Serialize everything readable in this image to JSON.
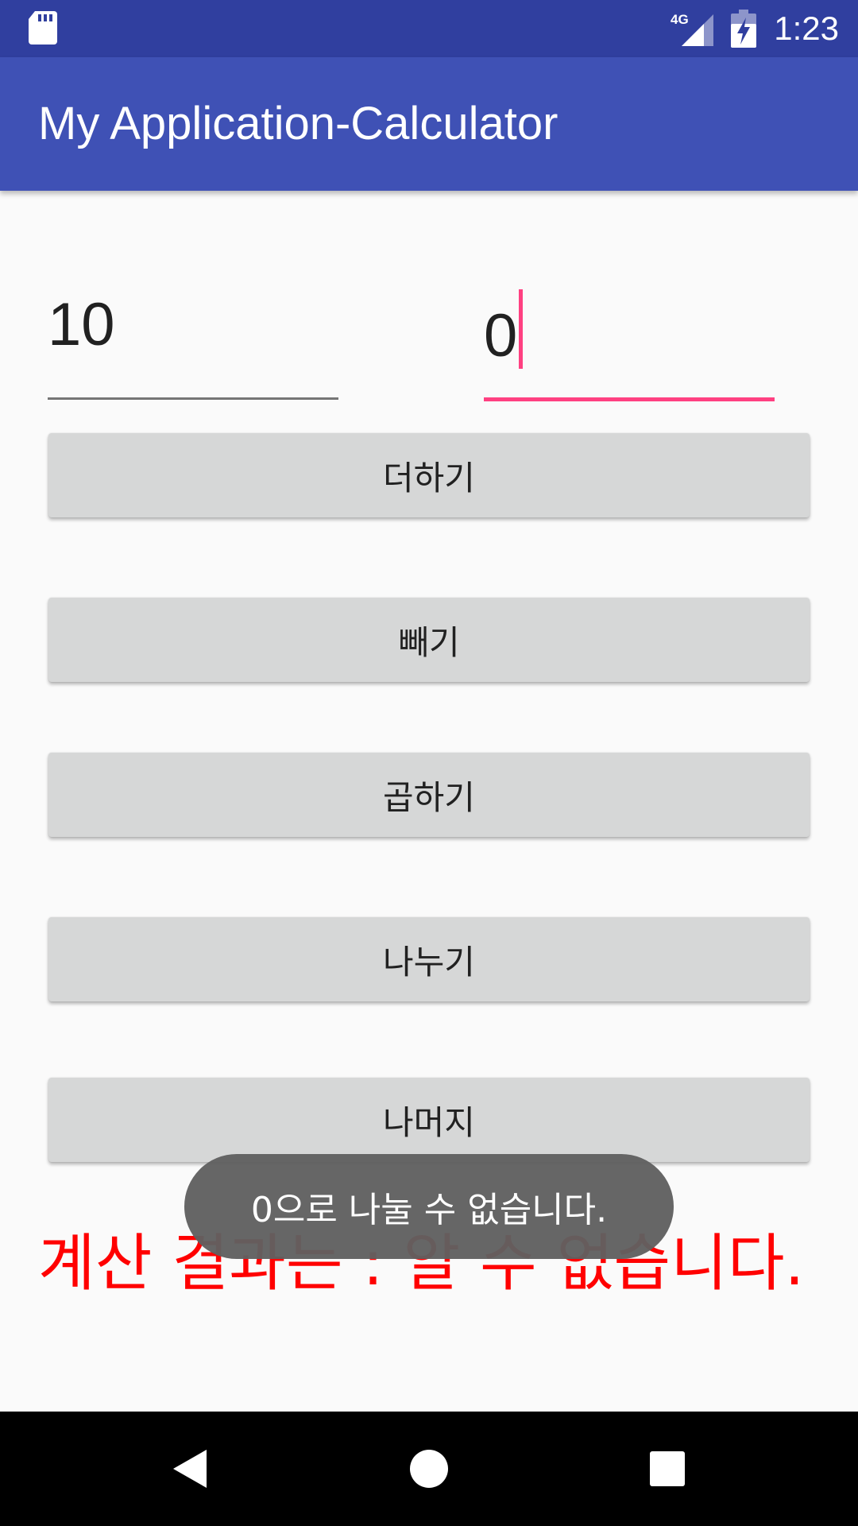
{
  "status_bar": {
    "time": "1:23",
    "network_label": "4G",
    "icons": [
      "sd-card-icon",
      "signal-4g-icon",
      "battery-charging-icon"
    ]
  },
  "app_bar": {
    "title": "My Application-Calculator"
  },
  "inputs": {
    "first_value": "10",
    "second_value": "0"
  },
  "buttons": {
    "add": "더하기",
    "subtract": "빼기",
    "multiply": "곱하기",
    "divide": "나누기",
    "remainder": "나머지"
  },
  "result": {
    "text": "계산 결과는 : 알 수 없습니다."
  },
  "toast": {
    "message": "0으로 나눌 수 없습니다."
  },
  "nav_bar": {
    "icons": [
      "back-icon",
      "home-icon",
      "recents-icon"
    ]
  },
  "colors": {
    "status_bar": "#303f9f",
    "app_bar": "#3f51b5",
    "accent": "#ff4081",
    "result_text": "#ff0000",
    "button_bg": "#d6d7d7"
  }
}
